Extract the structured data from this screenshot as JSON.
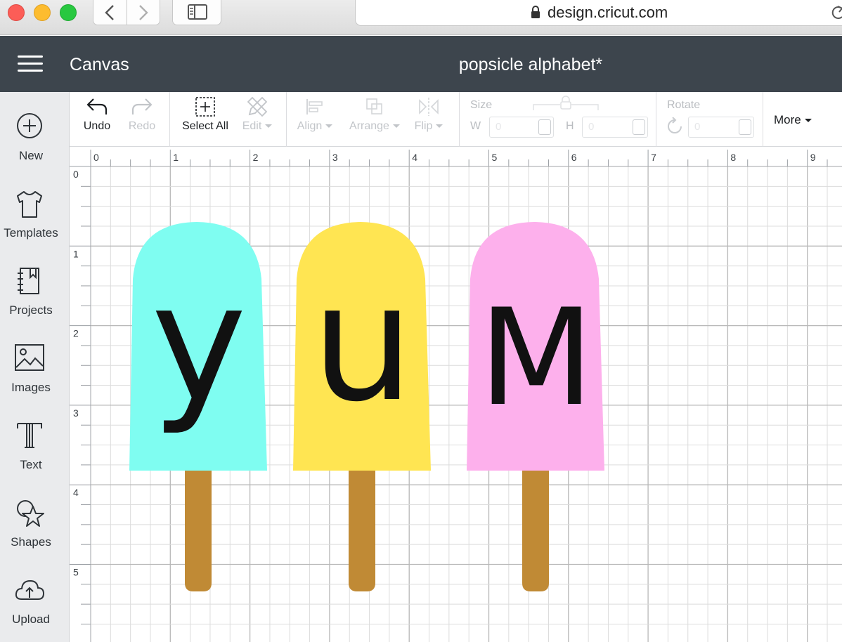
{
  "browser": {
    "url": "design.cricut.com"
  },
  "header": {
    "section": "Canvas",
    "project_title": "popsicle alphabet*"
  },
  "left_rail": {
    "items": [
      {
        "label": "New",
        "icon": "plus-circle-icon"
      },
      {
        "label": "Templates",
        "icon": "shirt-icon"
      },
      {
        "label": "Projects",
        "icon": "notebook-icon"
      },
      {
        "label": "Images",
        "icon": "image-icon"
      },
      {
        "label": "Text",
        "icon": "text-icon"
      },
      {
        "label": "Shapes",
        "icon": "shapes-icon"
      },
      {
        "label": "Upload",
        "icon": "cloud-upload-icon"
      }
    ]
  },
  "toolbar": {
    "undo": "Undo",
    "redo": "Redo",
    "select_all": "Select All",
    "edit": "Edit",
    "align": "Align",
    "arrange": "Arrange",
    "flip": "Flip",
    "size": "Size",
    "width_label": "W",
    "width_value": "0",
    "height_label": "H",
    "height_value": "0",
    "rotate": "Rotate",
    "rotate_value": "0",
    "more": "More"
  },
  "rulers": {
    "top_labels": [
      "0",
      "1",
      "2",
      "3",
      "4",
      "5",
      "6",
      "7",
      "8",
      "9"
    ],
    "left_labels": [
      "0",
      "1",
      "2",
      "3",
      "4",
      "5"
    ]
  },
  "canvas": {
    "popsicles": [
      {
        "letter": "y",
        "color": "#7ffdf1",
        "stick_color": "#c08a35"
      },
      {
        "letter": "u",
        "color": "#ffe552",
        "stick_color": "#c08a35"
      },
      {
        "letter": "m",
        "color": "#fdb0ec",
        "stick_color": "#c08a35"
      }
    ]
  },
  "colors": {
    "header_bg": "#3d454d",
    "rail_bg": "#eaebed",
    "grid_major": "#b8b8b8",
    "grid_minor": "#dcdcdc"
  }
}
